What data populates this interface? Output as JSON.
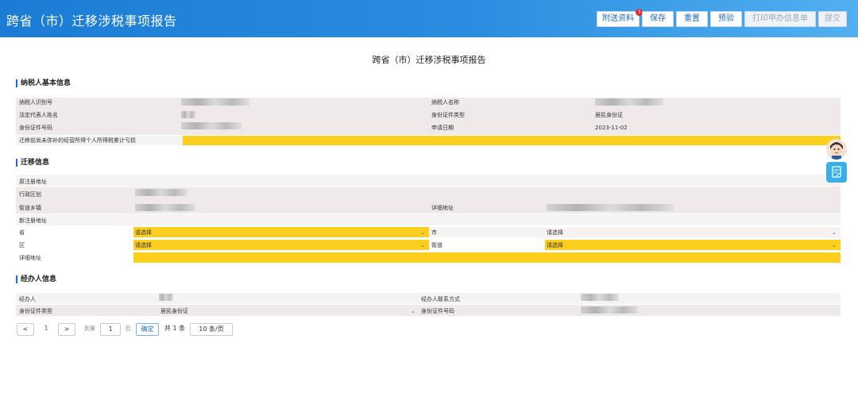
{
  "header": {
    "title": "跨省（市）迁移涉税事项报告",
    "buttons": [
      "附送资料",
      "保存",
      "重置",
      "预验",
      "打印申办信息单",
      "提交"
    ],
    "badge": "3"
  },
  "doc_title": "跨省（市）迁移涉税事项报告",
  "sections": {
    "basic": "纳税人基本信息",
    "migration": "迁移信息",
    "agent": "经办人信息"
  },
  "basic": {
    "taxpayer_id_label": "纳税人识别号",
    "taxpayer_name_label": "纳税人名称",
    "legal_rep_label": "法定代表人姓名",
    "id_type_label": "身份证件类型",
    "id_type_value": "居民身份证",
    "id_no_label": "身份证件号码",
    "apply_date_label": "申请日期",
    "apply_date_value": "2023-11-02",
    "unpaid_label": "迁移前尚未弥补的经营所得个人所得税累计亏损"
  },
  "migration": {
    "orig_addr_label": "原注册地址",
    "district_label": "行政区划",
    "street_label": "街道乡镇",
    "detail_addr_label": "详细地址",
    "new_addr_label": "新注册地址",
    "province_label": "省",
    "province_value": "请选择",
    "city_label": "市",
    "city_value": "请选择",
    "area_label": "区",
    "area_value": "请选择",
    "sub_street_label": "街道",
    "sub_street_value": "请选择",
    "new_detail_label": "详细地址"
  },
  "agent": {
    "agent_label": "经办人",
    "contact_label": "经办人联系方式",
    "id_type_label": "身份证件类型",
    "id_type_value": "居民身份证",
    "id_no_label": "身份证件号码"
  },
  "pagination": {
    "prev": "<",
    "page": "1",
    "next": ">",
    "goto": "到第",
    "goto_value": "1",
    "page_unit": "页",
    "confirm": "确定",
    "total": "共 1 条",
    "per_page": "10 条/页"
  }
}
